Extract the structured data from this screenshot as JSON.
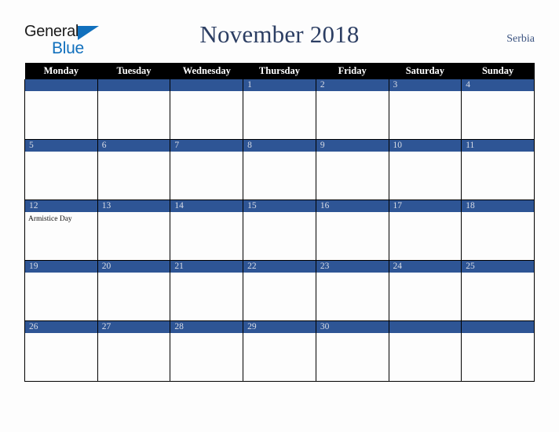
{
  "brand": {
    "line1": "General",
    "line2": "Blue",
    "triangle_color": "#1170bd",
    "text_color": "#1b1b1b"
  },
  "header": {
    "title": "November 2018",
    "title_color": "#2c3e63",
    "country": "Serbia",
    "country_color": "#3b5380"
  },
  "calendar": {
    "weekday_headers": [
      "Monday",
      "Tuesday",
      "Wednesday",
      "Thursday",
      "Friday",
      "Saturday",
      "Sunday"
    ],
    "header_bg": "#000000",
    "header_fg": "#ffffff",
    "daynum_bg": "#2e5595",
    "daynum_fg": "#d8dce6",
    "cell_bg": "#fdfdfd",
    "border_color": "#000000",
    "weeks": [
      [
        {
          "day": "",
          "events": []
        },
        {
          "day": "",
          "events": []
        },
        {
          "day": "",
          "events": []
        },
        {
          "day": "1",
          "events": []
        },
        {
          "day": "2",
          "events": []
        },
        {
          "day": "3",
          "events": []
        },
        {
          "day": "4",
          "events": []
        }
      ],
      [
        {
          "day": "5",
          "events": []
        },
        {
          "day": "6",
          "events": []
        },
        {
          "day": "7",
          "events": []
        },
        {
          "day": "8",
          "events": []
        },
        {
          "day": "9",
          "events": []
        },
        {
          "day": "10",
          "events": []
        },
        {
          "day": "11",
          "events": []
        }
      ],
      [
        {
          "day": "12",
          "events": [
            "Armistice Day"
          ]
        },
        {
          "day": "13",
          "events": []
        },
        {
          "day": "14",
          "events": []
        },
        {
          "day": "15",
          "events": []
        },
        {
          "day": "16",
          "events": []
        },
        {
          "day": "17",
          "events": []
        },
        {
          "day": "18",
          "events": []
        }
      ],
      [
        {
          "day": "19",
          "events": []
        },
        {
          "day": "20",
          "events": []
        },
        {
          "day": "21",
          "events": []
        },
        {
          "day": "22",
          "events": []
        },
        {
          "day": "23",
          "events": []
        },
        {
          "day": "24",
          "events": []
        },
        {
          "day": "25",
          "events": []
        }
      ],
      [
        {
          "day": "26",
          "events": []
        },
        {
          "day": "27",
          "events": []
        },
        {
          "day": "28",
          "events": []
        },
        {
          "day": "29",
          "events": []
        },
        {
          "day": "30",
          "events": []
        },
        {
          "day": "",
          "events": []
        },
        {
          "day": "",
          "events": []
        }
      ]
    ]
  }
}
